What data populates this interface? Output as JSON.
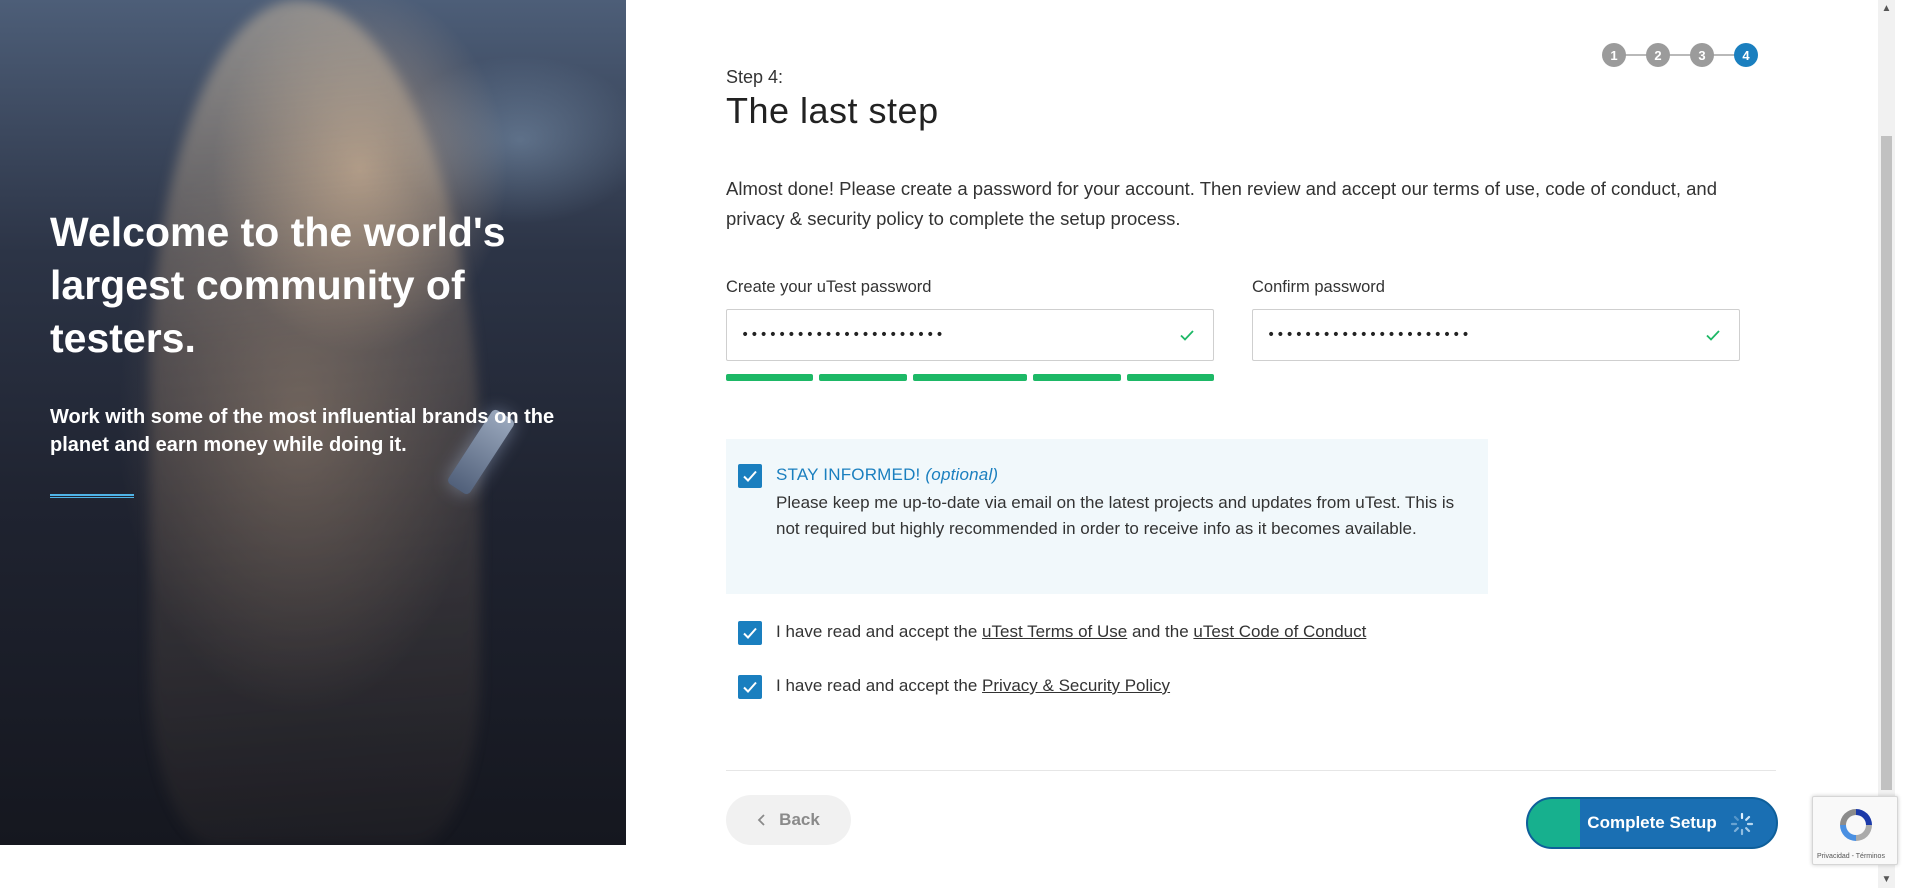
{
  "hero": {
    "title": "Welcome to the world's largest community of testers.",
    "subtitle": "Work with some of the most influential brands on the planet and earn money while doing it."
  },
  "stepper": {
    "steps": [
      "1",
      "2",
      "3",
      "4"
    ],
    "active_step": 4
  },
  "page": {
    "step_label": "Step 4:",
    "title": "The last step",
    "intro": "Almost done! Please create a password for your account. Then review and accept our terms of use, code of conduct, and privacy & security policy to complete the setup process."
  },
  "password": {
    "label": "Create your uTest password",
    "value": "••••••••••••••••••••••",
    "strength_segments": 5,
    "strength_filled": 5
  },
  "confirm": {
    "label": "Confirm password",
    "value": "••••••••••••••••••••••"
  },
  "stay_informed": {
    "title": "STAY INFORMED!",
    "optional": "(optional)",
    "text": "Please keep me up-to-date via email on the latest projects and updates from uTest. This is not required but highly recommended in order to receive info as it becomes available.",
    "checked": true
  },
  "terms": {
    "prefix": "I have read and accept the ",
    "link1": "uTest Terms of Use",
    "middle": " and the ",
    "link2": "uTest Code of Conduct",
    "checked": true
  },
  "privacy": {
    "prefix": "I have read and accept the ",
    "link": "Privacy & Security Policy",
    "checked": true
  },
  "buttons": {
    "back": "Back",
    "complete": "Complete Setup"
  },
  "recaptcha": {
    "links": "Privacidad - Términos"
  },
  "colors": {
    "accent": "#1a7fbf",
    "success": "#1db866",
    "button_teal": "#17b08e"
  }
}
